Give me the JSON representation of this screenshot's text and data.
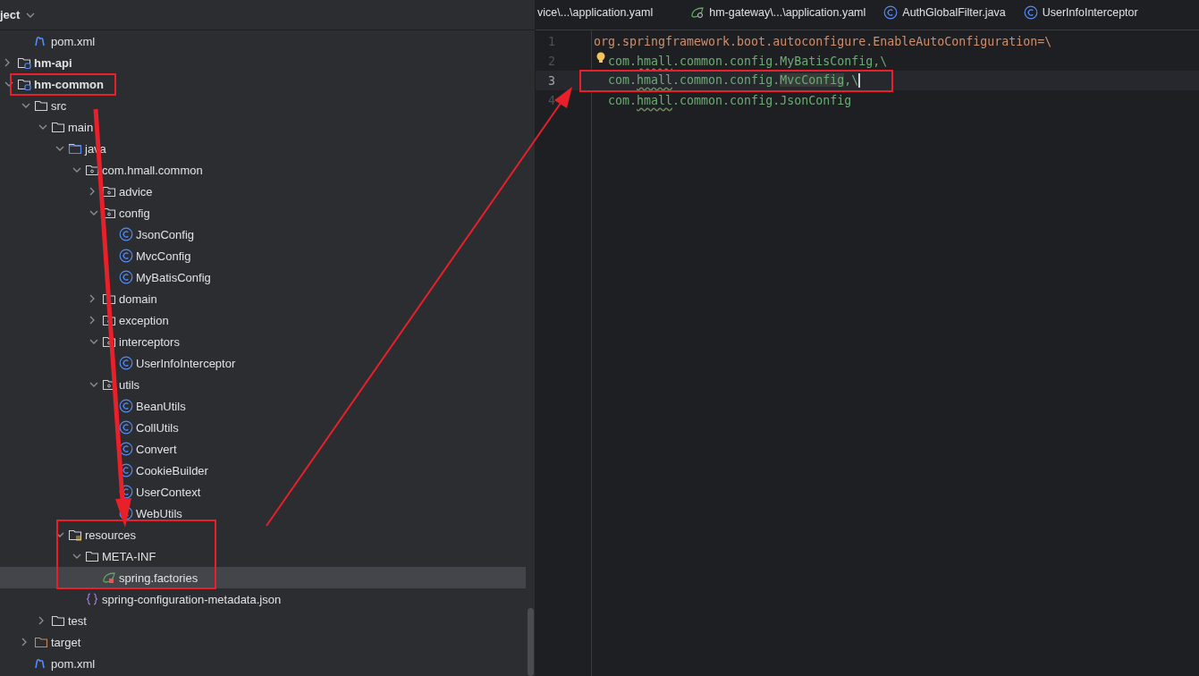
{
  "project_panel": {
    "title": "ject",
    "tree": {
      "leading": [
        {
          "name": "pom.xml",
          "kind": "maven",
          "selected": false
        }
      ],
      "items": [
        {
          "name": "hm-api",
          "kind": "module",
          "expanded": false,
          "selected": false
        },
        {
          "name": "hm-common",
          "kind": "module",
          "expanded": true,
          "selected": false,
          "children": [
            {
              "name": "src",
              "kind": "folder",
              "expanded": true,
              "selected": false,
              "children": [
                {
                  "name": "main",
                  "kind": "folder",
                  "expanded": true,
                  "selected": false,
                  "children": [
                    {
                      "name": "java",
                      "kind": "source-root",
                      "expanded": true,
                      "selected": false,
                      "children": [
                        {
                          "name": "com.hmall.common",
                          "kind": "package",
                          "expanded": true,
                          "selected": false,
                          "children": [
                            {
                              "name": "advice",
                              "kind": "package",
                              "expanded": false,
                              "selected": false
                            },
                            {
                              "name": "config",
                              "kind": "package",
                              "expanded": true,
                              "selected": false,
                              "children": [
                                {
                                  "name": "JsonConfig",
                                  "kind": "class",
                                  "selected": false
                                },
                                {
                                  "name": "MvcConfig",
                                  "kind": "class",
                                  "selected": false
                                },
                                {
                                  "name": "MyBatisConfig",
                                  "kind": "class",
                                  "selected": false
                                }
                              ]
                            },
                            {
                              "name": "domain",
                              "kind": "package",
                              "expanded": false,
                              "selected": false
                            },
                            {
                              "name": "exception",
                              "kind": "package",
                              "expanded": false,
                              "selected": false
                            },
                            {
                              "name": "interceptors",
                              "kind": "package",
                              "expanded": true,
                              "selected": false,
                              "children": [
                                {
                                  "name": "UserInfoInterceptor",
                                  "kind": "class",
                                  "selected": false
                                }
                              ]
                            },
                            {
                              "name": "utils",
                              "kind": "package",
                              "expanded": true,
                              "selected": false,
                              "children": [
                                {
                                  "name": "BeanUtils",
                                  "kind": "class",
                                  "selected": false
                                },
                                {
                                  "name": "CollUtils",
                                  "kind": "class",
                                  "selected": false
                                },
                                {
                                  "name": "Convert",
                                  "kind": "class",
                                  "selected": false
                                },
                                {
                                  "name": "CookieBuilder",
                                  "kind": "class",
                                  "selected": false
                                },
                                {
                                  "name": "UserContext",
                                  "kind": "class",
                                  "selected": false
                                },
                                {
                                  "name": "WebUtils",
                                  "kind": "class",
                                  "selected": false
                                }
                              ]
                            }
                          ]
                        }
                      ]
                    },
                    {
                      "name": "resources",
                      "kind": "resources-root",
                      "expanded": true,
                      "selected": false,
                      "children": [
                        {
                          "name": "META-INF",
                          "kind": "folder",
                          "expanded": true,
                          "selected": false,
                          "children": [
                            {
                              "name": "spring.factories",
                              "kind": "spring",
                              "selected": true
                            }
                          ]
                        },
                        {
                          "name": "spring-configuration-metadata.json",
                          "kind": "json",
                          "selected": false
                        }
                      ]
                    }
                  ]
                },
                {
                  "name": "test",
                  "kind": "folder",
                  "expanded": false,
                  "selected": false
                }
              ]
            },
            {
              "name": "target",
              "kind": "excluded-folder",
              "expanded": false,
              "selected": false
            },
            {
              "name": "pom.xml",
              "kind": "maven",
              "selected": false
            }
          ]
        }
      ]
    }
  },
  "editor": {
    "tabs": [
      {
        "label": "vice\\...\\application.yaml",
        "kind": "plain"
      },
      {
        "label": "hm-gateway\\...\\application.yaml",
        "kind": "spring"
      },
      {
        "label": "AuthGlobalFilter.java",
        "kind": "class"
      },
      {
        "label": "UserInfoInterceptor",
        "kind": "class"
      }
    ],
    "lines": [
      {
        "number": "1",
        "kind": "key",
        "current": false,
        "segments": [
          {
            "text": "org.springframework.boot.autoconfigure.EnableAutoConfiguration=\\",
            "kind": "key"
          }
        ]
      },
      {
        "number": "2",
        "kind": "continuation",
        "current": false,
        "bulb": true,
        "segments": [
          {
            "text": "com.",
            "kind": "value"
          },
          {
            "text": "hmall",
            "kind": "typo"
          },
          {
            "text": ".common.config.MyBatisConfig,\\",
            "kind": "value"
          }
        ]
      },
      {
        "number": "3",
        "kind": "continuation",
        "current": true,
        "bulb": false,
        "segments": [
          {
            "text": "com.",
            "kind": "value"
          },
          {
            "text": "hmall",
            "kind": "typo"
          },
          {
            "text": ".common.config.",
            "kind": "value"
          },
          {
            "text": "MvcConfig",
            "kind": "match"
          },
          {
            "text": ",\\",
            "kind": "value"
          }
        ]
      },
      {
        "number": "4",
        "kind": "continuation",
        "current": false,
        "bulb": false,
        "segments": [
          {
            "text": "com.",
            "kind": "value"
          },
          {
            "text": "hmall",
            "kind": "typo"
          },
          {
            "text": ".common.config.JsonConfig",
            "kind": "value"
          }
        ]
      }
    ]
  }
}
